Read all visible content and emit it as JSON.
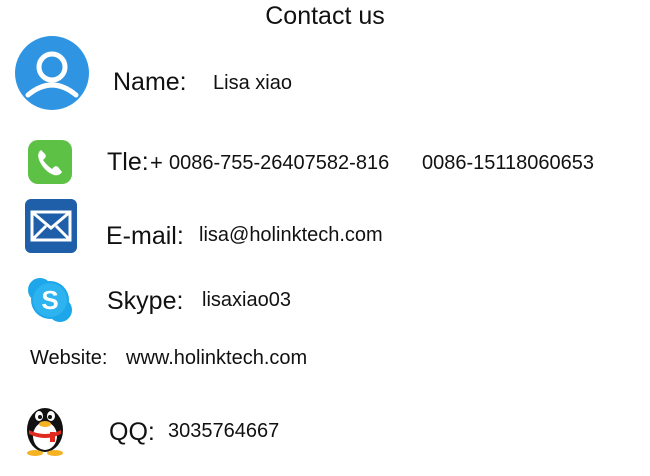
{
  "title": "Contact us",
  "contacts": {
    "name": {
      "label": "Name:",
      "value": "Lisa xiao",
      "icon": "user-icon"
    },
    "tel": {
      "label": "Tle:",
      "plus": "+",
      "value1": "0086-755-26407582-816",
      "value2": "0086-15118060653",
      "icon": "phone-icon"
    },
    "email": {
      "label": "E-mail:",
      "value": "lisa@holinktech.com",
      "icon": "mail-icon"
    },
    "skype": {
      "label": "Skype:",
      "value": "lisaxiao03",
      "icon": "skype-icon"
    },
    "website": {
      "label": "Website:",
      "value": "www.holinktech.com"
    },
    "qq": {
      "label": "QQ:",
      "value": "3035764667",
      "icon": "qq-penguin-icon"
    }
  },
  "colors": {
    "user_blue": "#2f95e3",
    "phone_green": "#5cc144",
    "mail_blue": "#1f5ea8",
    "skype_blue": "#1ea6ea",
    "qq_red": "#e02a1f",
    "qq_yellow": "#f5b324"
  }
}
